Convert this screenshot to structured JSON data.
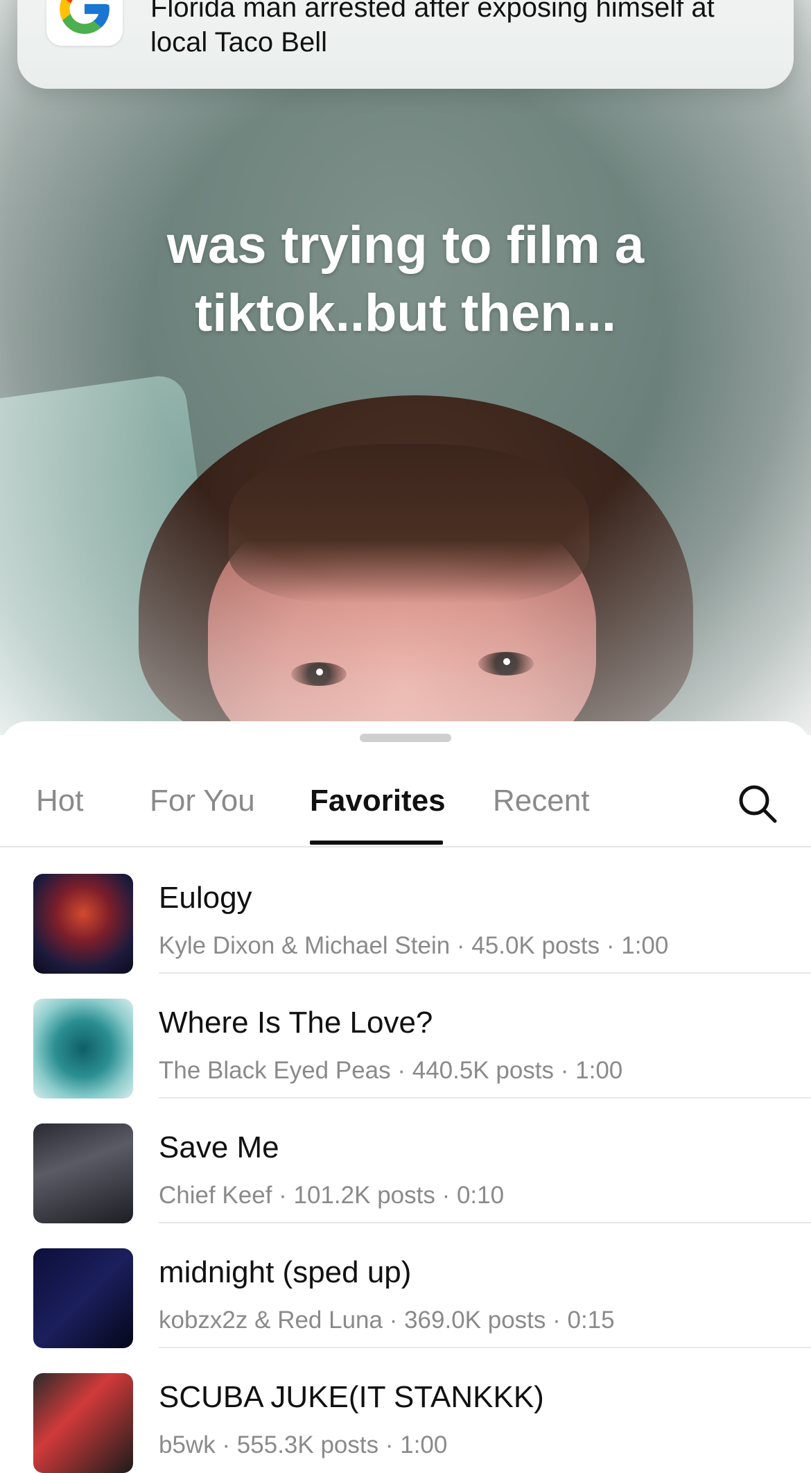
{
  "notification": {
    "app_icon": "google-g-icon",
    "text": "Florida man arrested after exposing himself at local Taco Bell"
  },
  "video": {
    "caption_line1": "was trying to film a",
    "caption_line2": "tiktok..but then..."
  },
  "sheet": {
    "tabs": [
      {
        "label": "Hot",
        "active": false
      },
      {
        "label": "For You",
        "active": false
      },
      {
        "label": "Favorites",
        "active": true
      },
      {
        "label": "Recent",
        "active": false
      }
    ],
    "search_icon": "search-icon",
    "sounds": [
      {
        "title": "Eulogy",
        "meta": "Kyle Dixon & Michael Stein · 45.0K posts · 1:00"
      },
      {
        "title": "Where Is The Love?",
        "meta": "The Black Eyed Peas · 440.5K posts · 1:00"
      },
      {
        "title": "Save Me",
        "meta": "Chief Keef · 101.2K posts · 0:10"
      },
      {
        "title": "midnight (sped up)",
        "meta": "kobzx2z & Red Luna · 369.0K posts · 0:15"
      },
      {
        "title": "SCUBA JUKE(IT STANKKK)",
        "meta": "b5wk · 555.3K posts · 1:00"
      }
    ]
  },
  "colors": {
    "active_tab": "#111111",
    "inactive_tab": "#8a8a8a",
    "caption": "#ffffff"
  }
}
